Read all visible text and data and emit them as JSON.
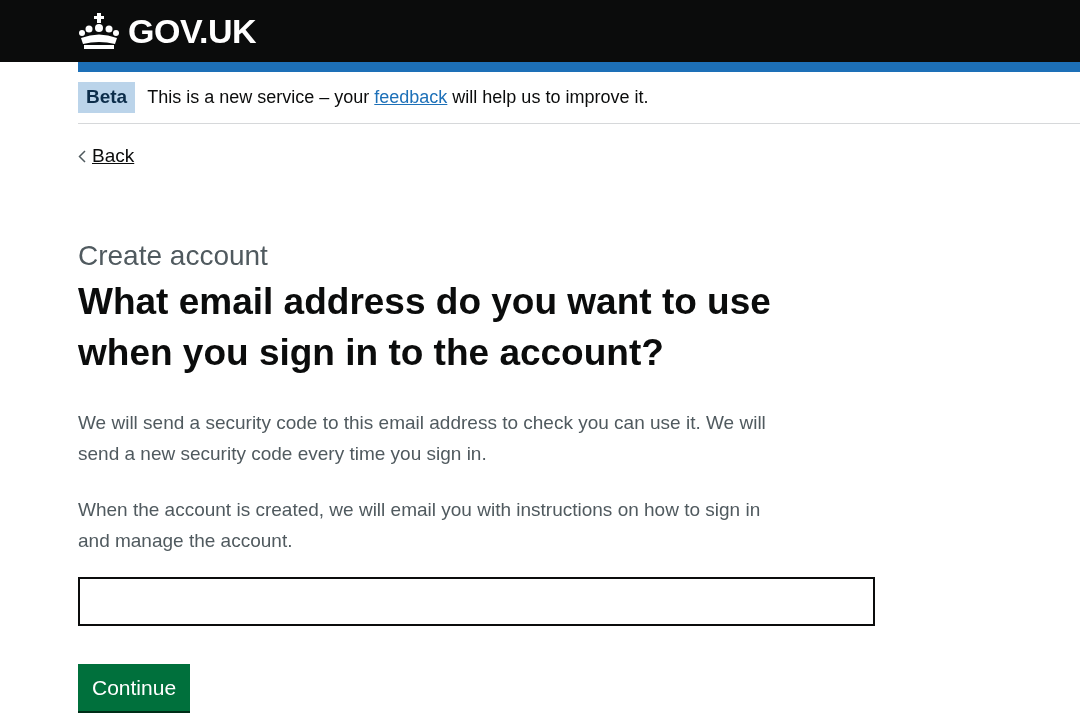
{
  "header": {
    "logo": "GOV.UK"
  },
  "phase_banner": {
    "tag": "Beta",
    "text_before": "This is a new service – your",
    "link": "feedback",
    "text_after": "will help us to improve it."
  },
  "back_link": "Back",
  "caption": "Create account",
  "heading": "What email address do you want to use when you sign in to the account?",
  "paragraphs": [
    "We will send a security code to this email address to check you can use it. We will send a new security code every time you sign in.",
    "When the account is created, we will email you with instructions on how to sign in and manage the account."
  ],
  "button": "Continue"
}
